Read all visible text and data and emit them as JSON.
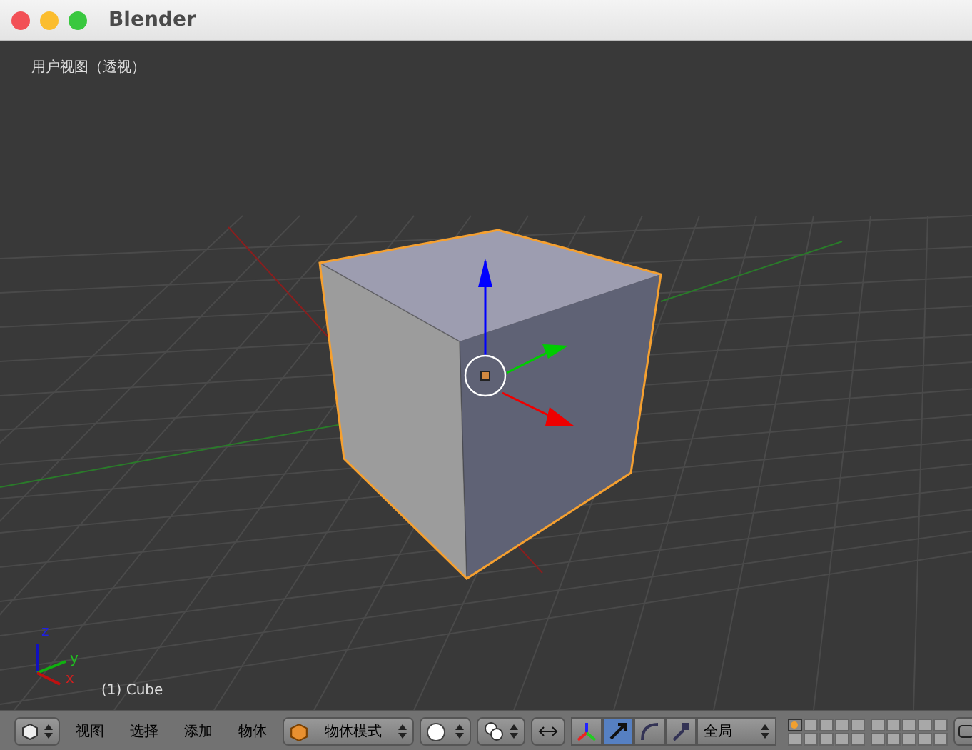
{
  "window": {
    "title": "Blender"
  },
  "viewport": {
    "view_label": "用户视图（透视）",
    "object_label": "(1) Cube",
    "axis_labels": [
      "z",
      "y",
      "x"
    ]
  },
  "header": {
    "menus": [
      "视图",
      "选择",
      "添加",
      "物体"
    ],
    "mode": {
      "label": "物体模式"
    },
    "manipulators": [
      {
        "kind": "toggle",
        "selected": false
      },
      {
        "kind": "translate",
        "selected": true
      },
      {
        "kind": "rotate",
        "selected": false
      },
      {
        "kind": "scale",
        "selected": false
      }
    ],
    "orientation": {
      "label": "全局"
    },
    "layers": [
      {
        "selected": true
      },
      {
        "selected": false
      },
      {
        "selected": false
      },
      {
        "selected": false
      },
      {
        "selected": false
      },
      {
        "selected": false
      },
      {
        "selected": false
      },
      {
        "selected": false
      },
      {
        "selected": false
      },
      {
        "selected": false
      },
      {
        "selected": false
      },
      {
        "selected": false
      },
      {
        "selected": false
      },
      {
        "selected": false
      },
      {
        "selected": false
      },
      {
        "selected": false
      },
      {
        "selected": false
      },
      {
        "selected": false
      },
      {
        "selected": false
      },
      {
        "selected": false
      }
    ]
  }
}
